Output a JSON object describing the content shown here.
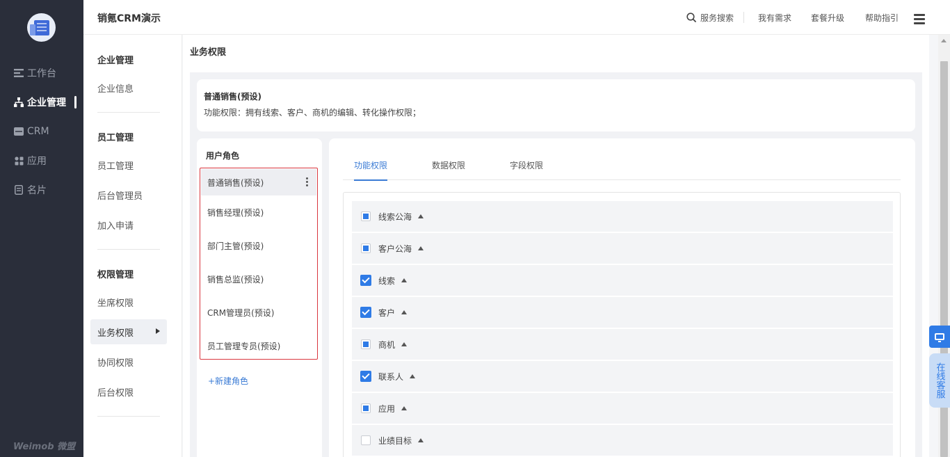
{
  "app": {
    "title": "销氪CRM演示",
    "brand": "Weimob 微盟"
  },
  "rail": {
    "items": [
      {
        "label": "工作台",
        "icon": "workbench-icon"
      },
      {
        "label": "企业管理",
        "icon": "org-icon",
        "active": true
      },
      {
        "label": "CRM",
        "icon": "crm-icon"
      },
      {
        "label": "应用",
        "icon": "apps-icon"
      },
      {
        "label": "名片",
        "icon": "card-icon"
      }
    ]
  },
  "topnav": {
    "search": "服务搜索",
    "needs": "我有需求",
    "upgrade": "套餐升级",
    "help": "帮助指引"
  },
  "submenu": {
    "groups": [
      {
        "head": "企业管理",
        "items": [
          "企业信息"
        ]
      },
      {
        "head": "员工管理",
        "items": [
          "员工管理",
          "后台管理员",
          "加入申请"
        ]
      },
      {
        "head": "权限管理",
        "items": [
          "坐席权限",
          "业务权限",
          "协同权限",
          "后台权限"
        ]
      }
    ],
    "active": "业务权限"
  },
  "page": {
    "title": "业务权限",
    "role_name": "普通销售(预设)",
    "role_desc": "功能权限：拥有线索、客户、商机的编辑、转化操作权限；"
  },
  "roles": {
    "heading": "用户角色",
    "items": [
      "普通销售(预设)",
      "销售经理(预设)",
      "部门主管(预设)",
      "销售总监(预设)",
      "CRM管理员(预设)",
      "员工管理专员(预设)"
    ],
    "add": "+新建角色"
  },
  "tabs": {
    "items": [
      "功能权限",
      "数据权限",
      "字段权限"
    ],
    "active": 0
  },
  "permissions": [
    {
      "label": "线索公海",
      "state": "partial"
    },
    {
      "label": "客户公海",
      "state": "partial"
    },
    {
      "label": "线索",
      "state": "checked"
    },
    {
      "label": "客户",
      "state": "checked"
    },
    {
      "label": "商机",
      "state": "partial"
    },
    {
      "label": "联系人",
      "state": "checked"
    },
    {
      "label": "应用",
      "state": "partial"
    },
    {
      "label": "业绩目标",
      "state": "unchecked"
    }
  ],
  "float": {
    "chat": "在线客服"
  },
  "colors": {
    "accent": "#2f7be6",
    "rail_bg": "#2a2e3a",
    "highlight_border": "#d9363e"
  }
}
